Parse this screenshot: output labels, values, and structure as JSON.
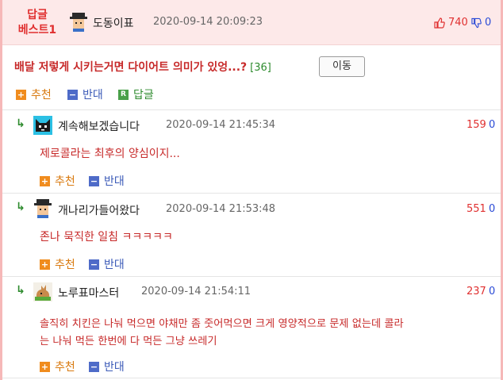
{
  "best_post": {
    "badge": "답글\n베스트1",
    "author": "도동이표",
    "datetime": "2020-09-14 20:09:23",
    "up_count": "740",
    "down_count": "0",
    "title": "배달 저렇게 시키는거면 다이어트 의미가 있엉...?",
    "comment_count": "[36]",
    "move_button": "이동",
    "actions": {
      "recommend": "추천",
      "oppose": "반대",
      "reply": "답글"
    },
    "reply_icon_text": "R"
  },
  "comments": [
    {
      "author": "계속해보겠습니다",
      "datetime": "2020-09-14 21:45:34",
      "up_count": "159",
      "down_count": "0",
      "text": "제로콜라는 최후의 양심이지...",
      "recommend": "추천",
      "oppose": "반대"
    },
    {
      "author": "개나리가들어왔다",
      "datetime": "2020-09-14 21:53:48",
      "up_count": "551",
      "down_count": "0",
      "text": "존나 묵직한 일침 ㅋㅋㅋㅋㅋ",
      "recommend": "추천",
      "oppose": "반대"
    },
    {
      "author": "노루표마스터",
      "datetime": "2020-09-14 21:54:11",
      "up_count": "237",
      "down_count": "0",
      "text_line1": "솔직히 치킨은 나눠 먹으면 야채만 좀 줏어먹으면 크게 영양적으로 문제 없는데 콜라",
      "text_line2": "는 나눠 먹든 한번에 다 먹든 그냥 쓰레기",
      "recommend": "추천",
      "oppose": "반대"
    }
  ],
  "icons": {
    "thumbs_up": "thumbs-up-icon",
    "thumbs_down": "thumbs-down-icon",
    "reply_arrow": "reply-arrow-icon"
  },
  "colors": {
    "accent_red": "#e03030",
    "header_bg": "#fde9e9",
    "border_pink": "#f6b8b8",
    "link_blue": "#2b4bd6",
    "recommend_orange": "#f08c1e",
    "oppose_blue": "#4e6bc8"
  }
}
